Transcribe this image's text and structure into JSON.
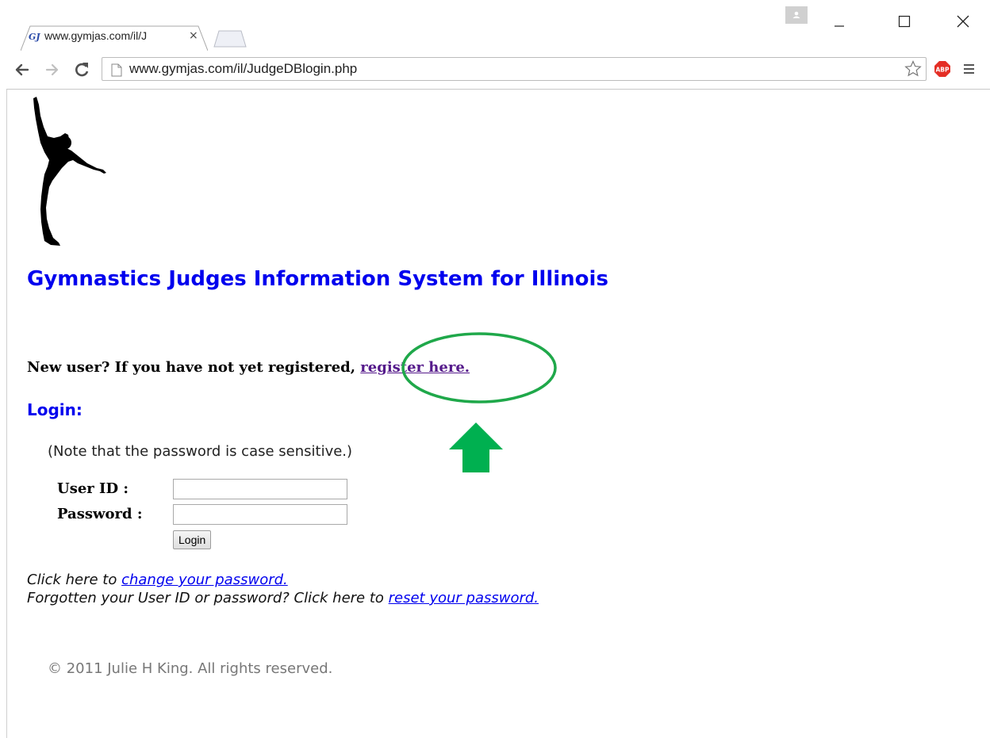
{
  "browser": {
    "tab": {
      "favicon_text": "GJ",
      "title": "www.gymjas.com/il/J",
      "close": "×"
    },
    "address": {
      "url": "www.gymjas.com/il/JudgeDBlogin.php"
    },
    "icons": [
      "back-arrow-icon",
      "forward-arrow-icon",
      "reload-icon",
      "page-icon",
      "star-icon",
      "adblock-plus-icon",
      "menu-icon"
    ],
    "window_controls": [
      "profile",
      "minimize",
      "maximize",
      "close"
    ]
  },
  "page": {
    "title": "Gymnastics Judges Information System for Illinois",
    "new_user_prefix": "New user? If you have not yet registered, ",
    "register_link": "register here.",
    "login_heading": "Login:",
    "note": "(Note that the password is case sensitive.)",
    "form": {
      "userid_label": "User ID :",
      "userid_value": "",
      "password_label": "Password :",
      "password_value": "",
      "login_button": "Login"
    },
    "change_prefix": "Click here to ",
    "change_link": "change your password.",
    "reset_prefix": "Forgotten your User ID or password? Click here to ",
    "reset_link": "reset your password.",
    "copyright": "© 2011 Julie H King. All rights reserved."
  },
  "annotations": {
    "highlight_color": "#1fa84a",
    "arrow_color": "#00b050"
  },
  "colors": {
    "title_blue": "#0000ee",
    "visited_link": "#551a8b",
    "link": "#0000ee"
  }
}
